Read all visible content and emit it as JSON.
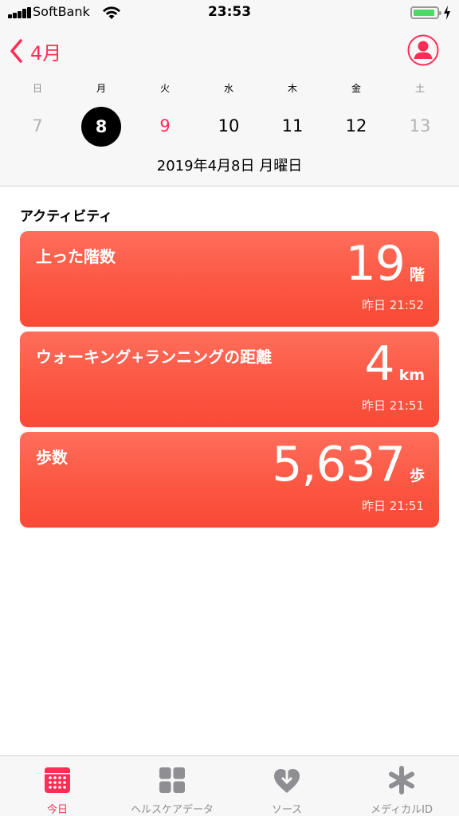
{
  "status_bar": {
    "carrier": "SoftBank",
    "time": "23:53"
  },
  "nav": {
    "back_label": "4月"
  },
  "calendar": {
    "weekdays": [
      "日",
      "月",
      "火",
      "水",
      "木",
      "金",
      "土"
    ],
    "dates": [
      "7",
      "8",
      "9",
      "10",
      "11",
      "12",
      "13"
    ],
    "selected_date": "8",
    "date_line": "2019年4月8日 月曜日"
  },
  "activity": {
    "section_title": "アクティビティ",
    "cards": [
      {
        "title": "上った階数",
        "value": "19",
        "unit": "階",
        "time": "昨日 21:52"
      },
      {
        "title": "ウォーキング+ランニングの距離",
        "value": "4",
        "unit": "km",
        "time": "昨日 21:51"
      },
      {
        "title": "歩数",
        "value": "5,637",
        "unit": "歩",
        "time": "昨日 21:51"
      }
    ]
  },
  "tabbar": {
    "tabs": [
      {
        "label": "今日",
        "icon": "calendar-icon"
      },
      {
        "label": "ヘルスケアデータ",
        "icon": "grid-icon"
      },
      {
        "label": "ソース",
        "icon": "heart-download-icon"
      },
      {
        "label": "メディカルID",
        "icon": "asterisk-icon"
      }
    ]
  },
  "colors": {
    "accent": "#ff2d55",
    "card_top": "#fe6e5b",
    "card_bottom": "#f94a36",
    "battery": "#4cd964"
  }
}
